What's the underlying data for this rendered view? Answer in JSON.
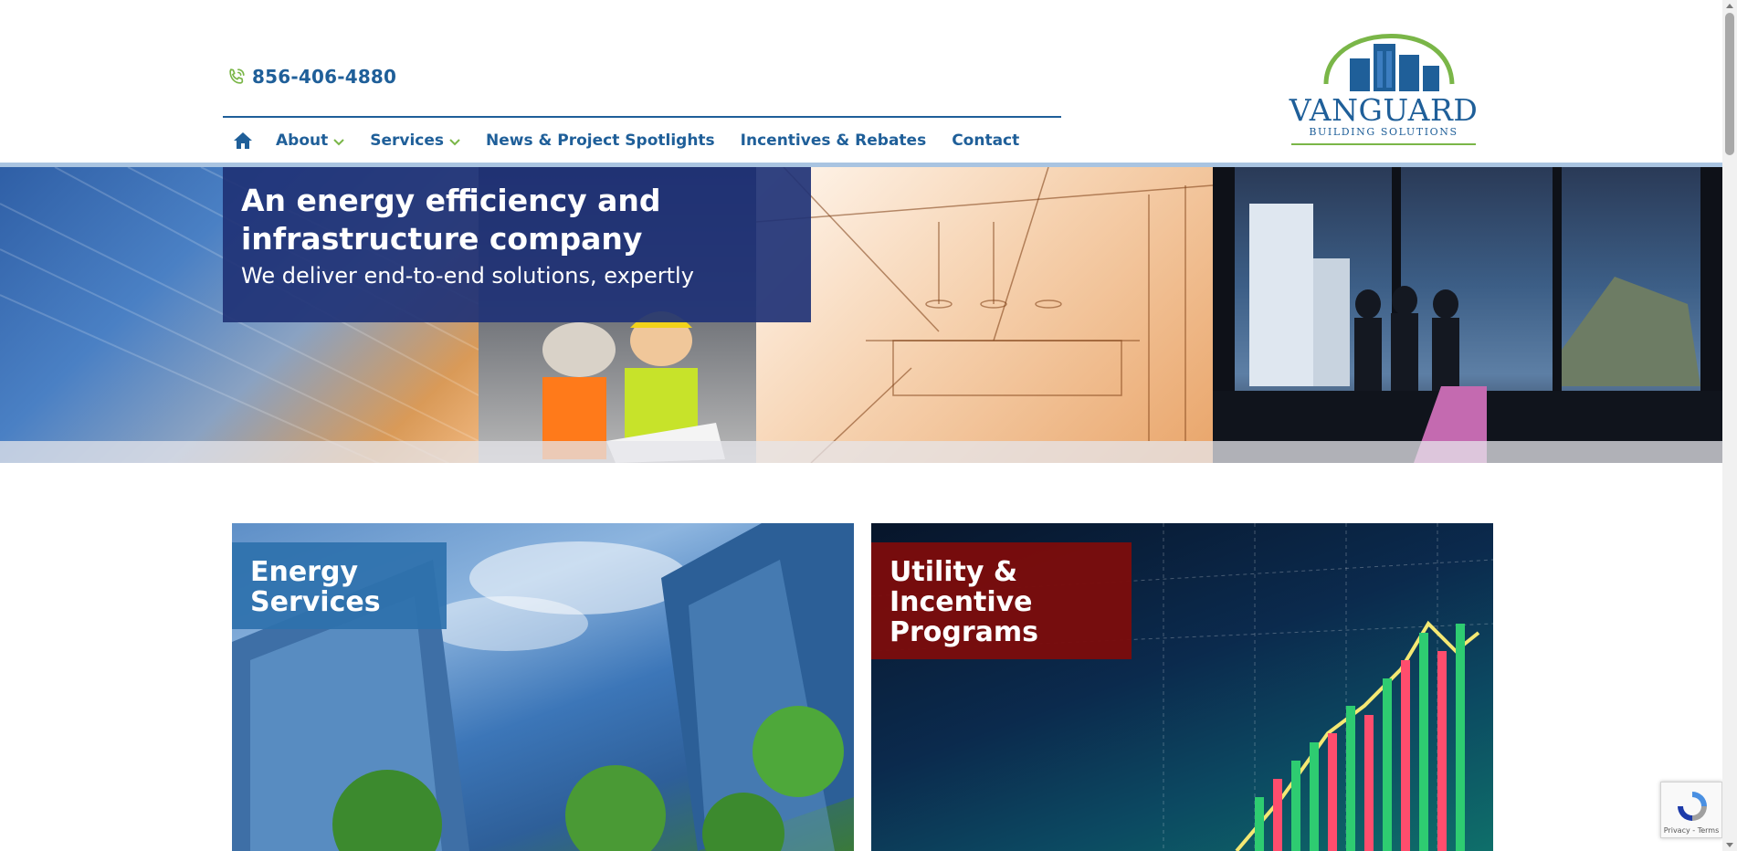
{
  "header": {
    "phone": "856-406-4880",
    "icons": {
      "phone": "phone-icon",
      "home": "home-icon",
      "dropdown": "chevron-down-icon"
    },
    "nav": [
      {
        "label": "About",
        "has_dropdown": true
      },
      {
        "label": "Services",
        "has_dropdown": true
      },
      {
        "label": "News & Project Spotlights",
        "has_dropdown": false
      },
      {
        "label": "Incentives & Rebates",
        "has_dropdown": false
      },
      {
        "label": "Contact",
        "has_dropdown": false
      }
    ]
  },
  "logo": {
    "wordmark": "VANGUARD",
    "tagline": "BUILDING SOLUTIONS"
  },
  "hero": {
    "title": "An energy efficiency and infrastructure company",
    "subtitle": "We deliver end-to-end solutions, expertly"
  },
  "cards": [
    {
      "label": "Energy Services"
    },
    {
      "label": "Utility & Incentive Programs"
    }
  ],
  "recaptcha": {
    "text": "Privacy - Terms"
  },
  "colors": {
    "brand_blue": "#1f5f99",
    "navy_overlay": "#203276",
    "accent_green": "#7ab648",
    "card_blue": "#2e71ad",
    "card_red": "#7a0c0c",
    "header_line": "#a9c4e1"
  }
}
